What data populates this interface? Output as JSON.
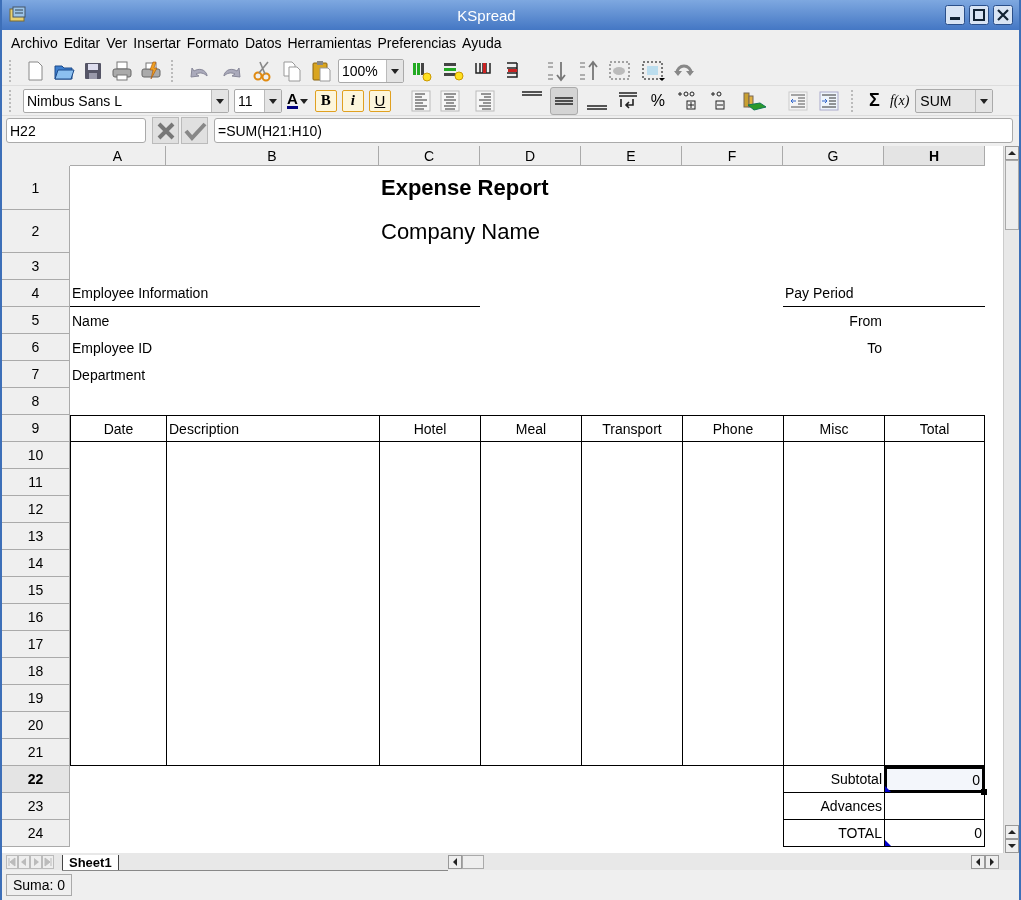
{
  "window": {
    "title": "KSpread"
  },
  "menu": [
    {
      "label": "Archivo"
    },
    {
      "label": "Editar"
    },
    {
      "label": "Ver"
    },
    {
      "label": "Insertar"
    },
    {
      "label": "Formato"
    },
    {
      "label": "Datos"
    },
    {
      "label": "Herramientas"
    },
    {
      "label": "Preferencias"
    },
    {
      "label": "Ayuda"
    }
  ],
  "main_toolbar": {
    "zoom": "100%"
  },
  "format_toolbar": {
    "font": "Nimbus Sans L",
    "size": "11",
    "font_color": "A",
    "bold": "B",
    "italic": "i",
    "underline": "U",
    "percent": "%",
    "sum": "Σ",
    "function": "f(x)",
    "function_name": "SUM",
    "valign_middle_pressed": true
  },
  "formula_bar": {
    "cell": "H22",
    "formula": "=SUM(H21:H10)"
  },
  "sheet": {
    "columns": [
      {
        "label": "A",
        "selected": false
      },
      {
        "label": "B",
        "selected": false
      },
      {
        "label": "C",
        "selected": false
      },
      {
        "label": "D",
        "selected": false
      },
      {
        "label": "E",
        "selected": false
      },
      {
        "label": "F",
        "selected": false
      },
      {
        "label": "G",
        "selected": false
      },
      {
        "label": "H",
        "selected": true
      }
    ],
    "rows": [
      {
        "number": "1",
        "selected": false,
        "kind": "title",
        "cells": {
          "C": {
            "text": "Expense Report",
            "selected": false,
            "marker": false
          }
        }
      },
      {
        "number": "2",
        "selected": false,
        "kind": "subtitle",
        "cells": {
          "C": {
            "text": "Company Name",
            "selected": false,
            "marker": false
          }
        }
      },
      {
        "number": "3",
        "selected": false,
        "kind": "blank",
        "cells": {}
      },
      {
        "number": "4",
        "selected": false,
        "kind": "section",
        "cells": {
          "A": {
            "text": "Employee Information",
            "selected": false,
            "marker": false
          },
          "G": {
            "text": "Pay Period",
            "selected": false,
            "marker": false
          }
        }
      },
      {
        "number": "5",
        "selected": false,
        "kind": "field",
        "cells": {
          "A": {
            "text": "Name",
            "selected": false,
            "marker": false
          },
          "G": {
            "text": "From",
            "selected": false,
            "marker": false
          }
        }
      },
      {
        "number": "6",
        "selected": false,
        "kind": "field",
        "cells": {
          "A": {
            "text": "Employee ID",
            "selected": false,
            "marker": false
          },
          "G": {
            "text": "To",
            "selected": false,
            "marker": false
          }
        }
      },
      {
        "number": "7",
        "selected": false,
        "kind": "field",
        "cells": {
          "A": {
            "text": "Department",
            "selected": false,
            "marker": false
          }
        }
      },
      {
        "number": "8",
        "selected": false,
        "kind": "blank",
        "cells": {}
      },
      {
        "number": "9",
        "selected": false,
        "kind": "table-header",
        "cells": {
          "A": {
            "text": "Date",
            "selected": false,
            "marker": false
          },
          "B": {
            "text": "Description",
            "selected": false,
            "marker": false
          },
          "C": {
            "text": "Hotel",
            "selected": false,
            "marker": false
          },
          "D": {
            "text": "Meal",
            "selected": false,
            "marker": false
          },
          "E": {
            "text": "Transport",
            "selected": false,
            "marker": false
          },
          "F": {
            "text": "Phone",
            "selected": false,
            "marker": false
          },
          "G": {
            "text": "Misc",
            "selected": false,
            "marker": false
          },
          "H": {
            "text": "Total",
            "selected": false,
            "marker": false
          }
        }
      },
      {
        "number": "10",
        "selected": false,
        "kind": "table-body",
        "cells": {}
      },
      {
        "number": "11",
        "selected": false,
        "kind": "table-body",
        "cells": {}
      },
      {
        "number": "12",
        "selected": false,
        "kind": "table-body",
        "cells": {}
      },
      {
        "number": "13",
        "selected": false,
        "kind": "table-body",
        "cells": {}
      },
      {
        "number": "14",
        "selected": false,
        "kind": "table-body",
        "cells": {}
      },
      {
        "number": "15",
        "selected": false,
        "kind": "table-body",
        "cells": {}
      },
      {
        "number": "16",
        "selected": false,
        "kind": "table-body",
        "cells": {}
      },
      {
        "number": "17",
        "selected": false,
        "kind": "table-body",
        "cells": {}
      },
      {
        "number": "18",
        "selected": false,
        "kind": "table-body",
        "cells": {}
      },
      {
        "number": "19",
        "selected": false,
        "kind": "table-body",
        "cells": {}
      },
      {
        "number": "20",
        "selected": false,
        "kind": "table-body",
        "cells": {}
      },
      {
        "number": "21",
        "selected": false,
        "kind": "table-end",
        "cells": {}
      },
      {
        "number": "22",
        "selected": true,
        "kind": "summary",
        "cells": {
          "G": {
            "text": "Subtotal",
            "selected": false,
            "marker": false
          },
          "H": {
            "text": "0",
            "selected": true,
            "marker": true
          }
        }
      },
      {
        "number": "23",
        "selected": false,
        "kind": "summary",
        "cells": {
          "G": {
            "text": "Advances",
            "selected": false,
            "marker": false
          }
        }
      },
      {
        "number": "24",
        "selected": false,
        "kind": "summary",
        "cells": {
          "G": {
            "text": "TOTAL",
            "selected": false,
            "marker": false
          },
          "H": {
            "text": "0",
            "selected": false,
            "marker": true
          }
        }
      }
    ]
  },
  "sheet_tabs": [
    {
      "label": "Sheet1",
      "selected": true
    }
  ],
  "status_bar": {
    "text": "Suma: 0"
  }
}
